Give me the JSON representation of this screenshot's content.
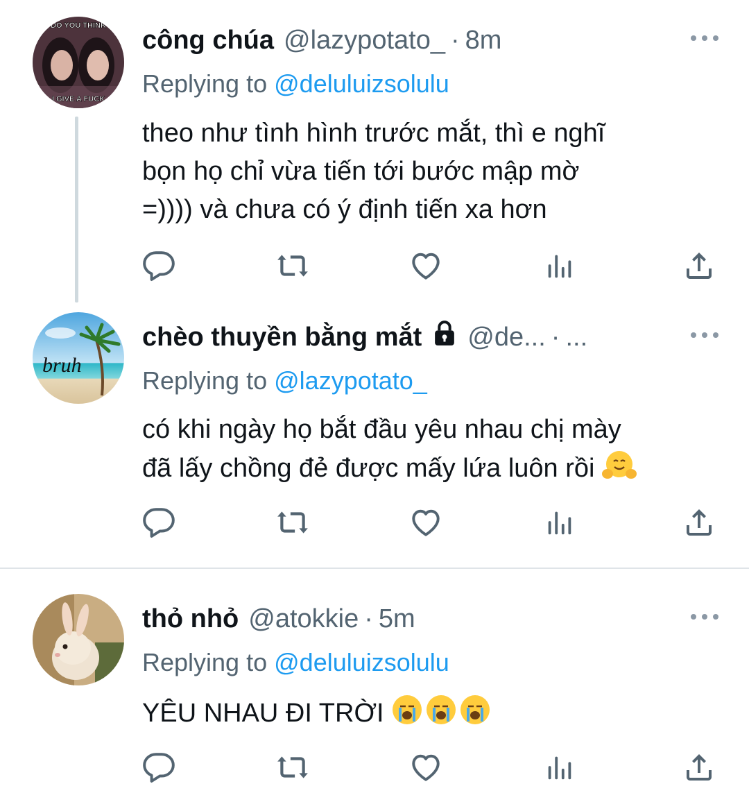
{
  "tweets": [
    {
      "name": "công chúa",
      "handle": "@lazypotato_",
      "separator": "·",
      "time": "8m",
      "replying_prefix": "Replying to",
      "replying_to": "@deluluizsolulu",
      "avatar_caption_top": "DO YOU THINK",
      "avatar_caption_bottom": "I GIVE A FUCK",
      "body_lines": [
        "theo như tình hình trước mắt, thì e nghĩ",
        "bọn họ chỉ vừa tiến tới bước mập mờ",
        "=)))) và chưa có ý định tiến xa hơn"
      ]
    },
    {
      "name": "chèo thuyền bằng mắt",
      "handle": "@de...",
      "separator": "·",
      "time": "...",
      "replying_prefix": "Replying to",
      "replying_to": "@lazypotato_",
      "avatar_caption": "bruh",
      "protected_icon": "lock-icon",
      "body_lines": [
        "có khi ngày họ bắt đầu yêu nhau chị mày",
        "đã lấy chồng đẻ được mấy lứa luôn rồi"
      ],
      "body_emoji": "hugging-face-emoji"
    },
    {
      "name": "thỏ nhỏ",
      "handle": "@atokkie",
      "separator": "·",
      "time": "5m",
      "replying_prefix": "Replying to",
      "replying_to": "@deluluizsolulu",
      "body_lines": [
        "YÊU NHAU ĐI TRỜI"
      ],
      "body_emoji": "loudly-crying-face-emoji x3"
    }
  ],
  "action_icons": [
    "reply-icon",
    "retweet-icon",
    "like-icon",
    "views-icon",
    "share-icon"
  ],
  "colors": {
    "text": "#0f1419",
    "secondary": "#536471",
    "link": "#1d9bf0",
    "icon": "#536471",
    "thread_line": "#cfd9de"
  }
}
